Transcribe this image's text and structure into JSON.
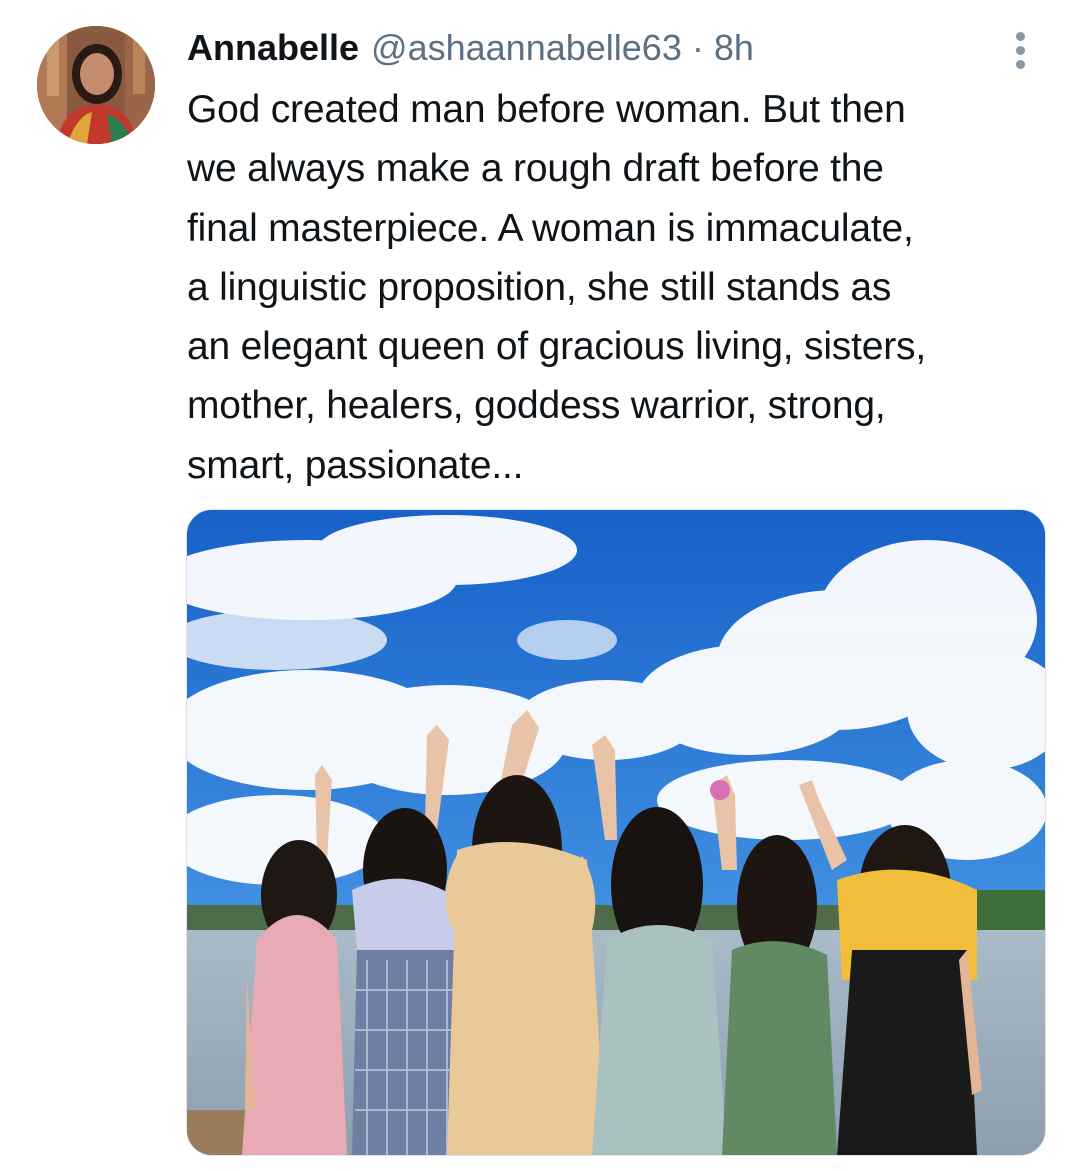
{
  "tweet": {
    "author": {
      "display_name": "Annabelle",
      "handle": "@ashaannabelle63",
      "avatar_icon": "profile-photo-avatar"
    },
    "separator": "·",
    "timestamp": "8h",
    "more_icon": "more-vertical-icon",
    "text": "God created man before woman. But then\nwe always make a rough draft before the\nfinal masterpiece. A woman is immaculate,\na linguistic proposition, she still stands as\nan elegant queen of gracious living, sisters,\nmother, healers, goddess warrior, strong,\nsmart, passionate...",
    "media": {
      "type": "photo",
      "icon": "photo-six-women-waving-at-sky"
    }
  },
  "colors": {
    "text_primary": "#0f1419",
    "text_secondary": "#5b7083",
    "sky": "#1f6fd0",
    "cloud": "#ffffff"
  }
}
